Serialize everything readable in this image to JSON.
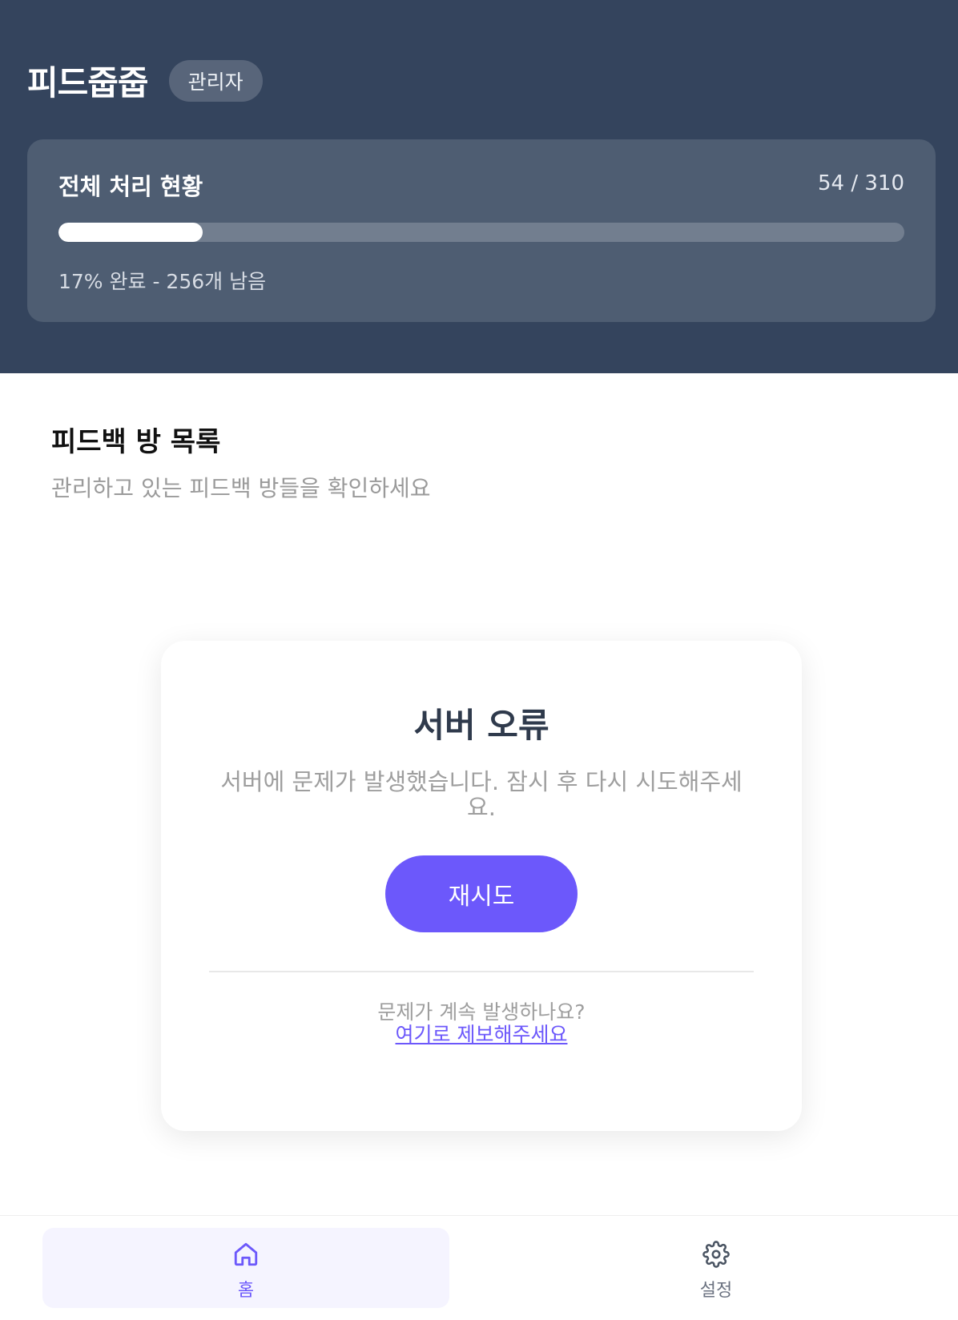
{
  "app": {
    "title": "피드줍줍",
    "role_badge": "관리자"
  },
  "progress": {
    "title": "전체 처리 현황",
    "count_label": "54 / 310",
    "fraction": 0.17,
    "summary": "17% 완료 - 256개 남음"
  },
  "section": {
    "title": "피드백 방 목록",
    "subtitle": "관리하고 있는 피드백 방들을 확인하세요"
  },
  "error": {
    "title": "서버 오류",
    "message": "서버에 문제가 발생했습니다. 잠시 후 다시 시도해주세요.",
    "retry_label": "재시도",
    "help_question": "문제가 계속 발생하나요?",
    "help_link": "여기로 제보해주세요"
  },
  "nav": {
    "home_label": "홈",
    "home_icon": "home-icon",
    "settings_label": "설정",
    "settings_icon": "gear-icon"
  },
  "colors": {
    "header_bg": "#34445d",
    "accent": "#6c58fb"
  }
}
